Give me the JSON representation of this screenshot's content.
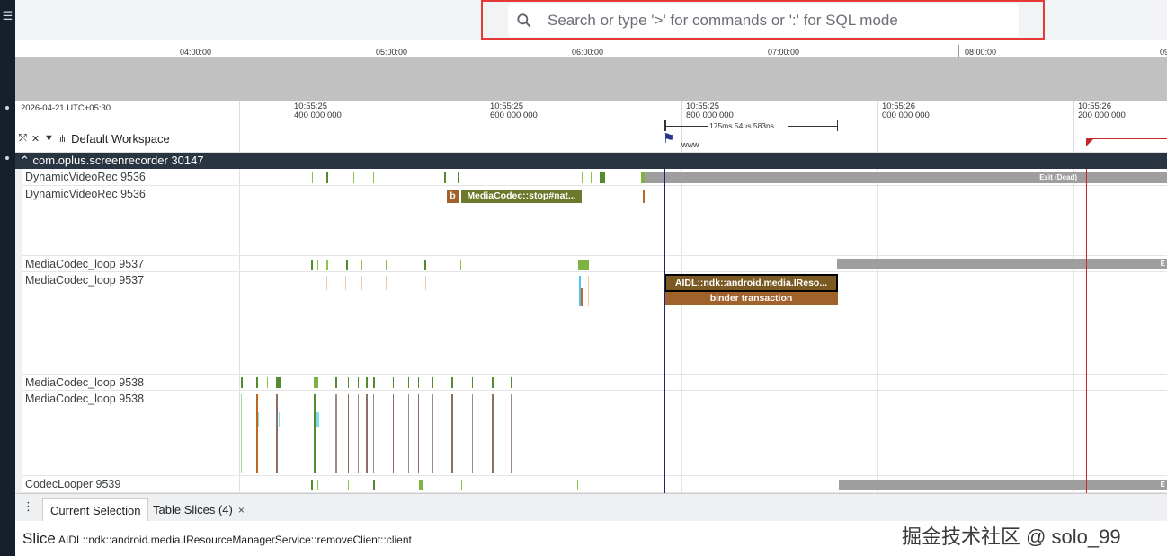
{
  "search": {
    "placeholder": "Search or type '>' for commands or ':' for SQL mode"
  },
  "overview": {
    "ticks": [
      "04:00:00",
      "05:00:00",
      "06:00:00",
      "07:00:00",
      "08:00:00",
      "09"
    ]
  },
  "timeline": {
    "date": "2026-04-21 UTC+05:30",
    "ticks": [
      "10:55:25\n400 000 000",
      "10:55:25\n600 000 000",
      "10:55:25\n800 000 000",
      "10:55:26\n000 000 000",
      "10:55:26\n200 000 000"
    ],
    "measure": "175ms 54µs 583ns",
    "flag_label": "www"
  },
  "workspace": {
    "label": "Default Workspace"
  },
  "process": {
    "header": "com.oplus.screenrecorder 30147"
  },
  "tracks": [
    {
      "name": "DynamicVideoRec 9536"
    },
    {
      "name": "DynamicVideoRec 9536"
    },
    {
      "name": "MediaCodec_loop 9537"
    },
    {
      "name": "MediaCodec_loop 9537"
    },
    {
      "name": "MediaCodec_loop 9538"
    },
    {
      "name": "MediaCodec_loop 9538"
    },
    {
      "name": "CodecLooper 9539"
    }
  ],
  "slices": {
    "exit_dead": "Exit (Dead)",
    "b": "b",
    "stop": "MediaCodec::stop#nat...",
    "aidl": "AIDL::ndk::android.media.IReso...",
    "binder": "binder transaction",
    "e1": "E",
    "e2": "E"
  },
  "tabs": {
    "current": "Current Selection",
    "table": "Table Slices (4)",
    "close": "×"
  },
  "details": {
    "title": "Slice",
    "name": "AIDL::ndk::android.media.IResourceManagerService::removeClient::client"
  },
  "watermark": "掘金技术社区 @ solo_99",
  "colors": {
    "accent_red": "#e53935",
    "process_header": "#2a3542",
    "slice_olive": "#6b7a2a",
    "slice_brown": "#a0612b",
    "slice_dark_brown": "#7a5a22",
    "cursor": "#1a237e",
    "exit_gray": "#9e9e9e"
  },
  "icons": [
    "search-icon",
    "menu-icon",
    "collapse-icon",
    "pin-off-icon",
    "filter-icon",
    "workspace-icon",
    "flag-icon",
    "chevron-up-icon",
    "kebab-icon",
    "close-icon"
  ]
}
